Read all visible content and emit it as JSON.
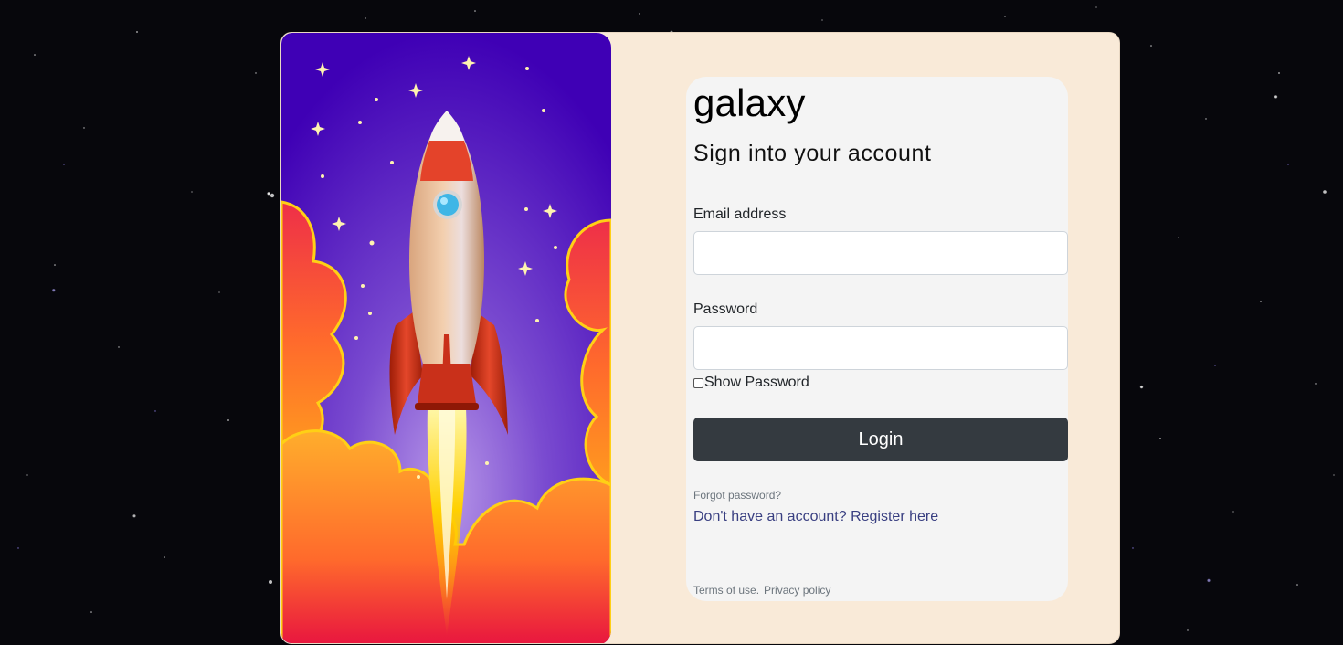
{
  "background": {
    "color": "#07070c"
  },
  "hero": {
    "illustration": "rocket-launch-illustration",
    "colors": {
      "sky_top": "#3f00b5",
      "sky_mid": "#7a4bd0",
      "cloud_red": "#ee3b3b",
      "cloud_orange": "#ff8a24",
      "cloud_yellow": "#ffd015"
    }
  },
  "card": {
    "background": "#f9ead8"
  },
  "form": {
    "brand": "galaxy",
    "subtitle": "Sign into your account",
    "email_label": "Email address",
    "email_value": "",
    "password_label": "Password",
    "password_value": "",
    "show_password_label": "Show Password",
    "show_password_checked": false,
    "login_label": "Login",
    "forgot_label": "Forgot password?",
    "register_prefix": "Don't have an account? ",
    "register_link": "Register here",
    "terms_label": "Terms of use.",
    "privacy_label": "Privacy policy",
    "button_color": "#343a40",
    "link_color": "#393f81"
  }
}
